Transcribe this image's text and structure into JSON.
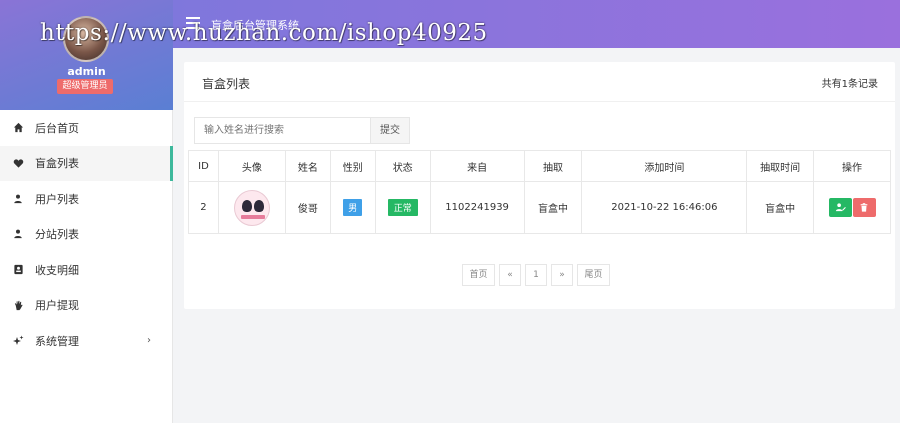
{
  "watermark": "https://www.huzhan.com/ishop40925",
  "sidebar": {
    "user": {
      "name": "admin",
      "role": "超级管理员"
    },
    "items": [
      {
        "label": "后台首页",
        "icon": "home-icon",
        "glyph": "⌂"
      },
      {
        "label": "盲盒列表",
        "icon": "heart-icon",
        "glyph": "♥"
      },
      {
        "label": "用户列表",
        "icon": "user-icon",
        "glyph": "●"
      },
      {
        "label": "分站列表",
        "icon": "user-icon",
        "glyph": "●"
      },
      {
        "label": "收支明细",
        "icon": "address-card-icon",
        "glyph": "▣"
      },
      {
        "label": "用户提现",
        "icon": "hand-icon",
        "glyph": "✋"
      },
      {
        "label": "系统管理",
        "icon": "sparkles-icon",
        "glyph": "✦",
        "arrow": "›"
      }
    ]
  },
  "header": {
    "title": "盲盒后台管理系统"
  },
  "card": {
    "title": "盲盒列表",
    "count": "共有1条记录",
    "search": {
      "placeholder": "输入姓名进行搜索",
      "button": "提交"
    }
  },
  "table": {
    "columns": [
      "ID",
      "头像",
      "姓名",
      "性别",
      "状态",
      "来自",
      "抽取",
      "添加时间",
      "抽取时间",
      "操作"
    ],
    "rows": [
      {
        "id": "2",
        "name": "俊哥",
        "gender": "男",
        "status": "正常",
        "from": "1102241939",
        "draw": "盲盒中",
        "added_time": "2021-10-22 16:46:06",
        "draw_time": "盲盒中"
      }
    ]
  },
  "pagination": {
    "first": "首页",
    "prev": "«",
    "page": "1",
    "next": "»",
    "last": "尾页"
  },
  "colors": {
    "header_gradient_start": "#7f77dc",
    "header_gradient_end": "#9a70dd",
    "active_bar": "#3db89c",
    "success": "#25b864",
    "danger": "#ee6b6b",
    "info": "#3fa0e8"
  }
}
